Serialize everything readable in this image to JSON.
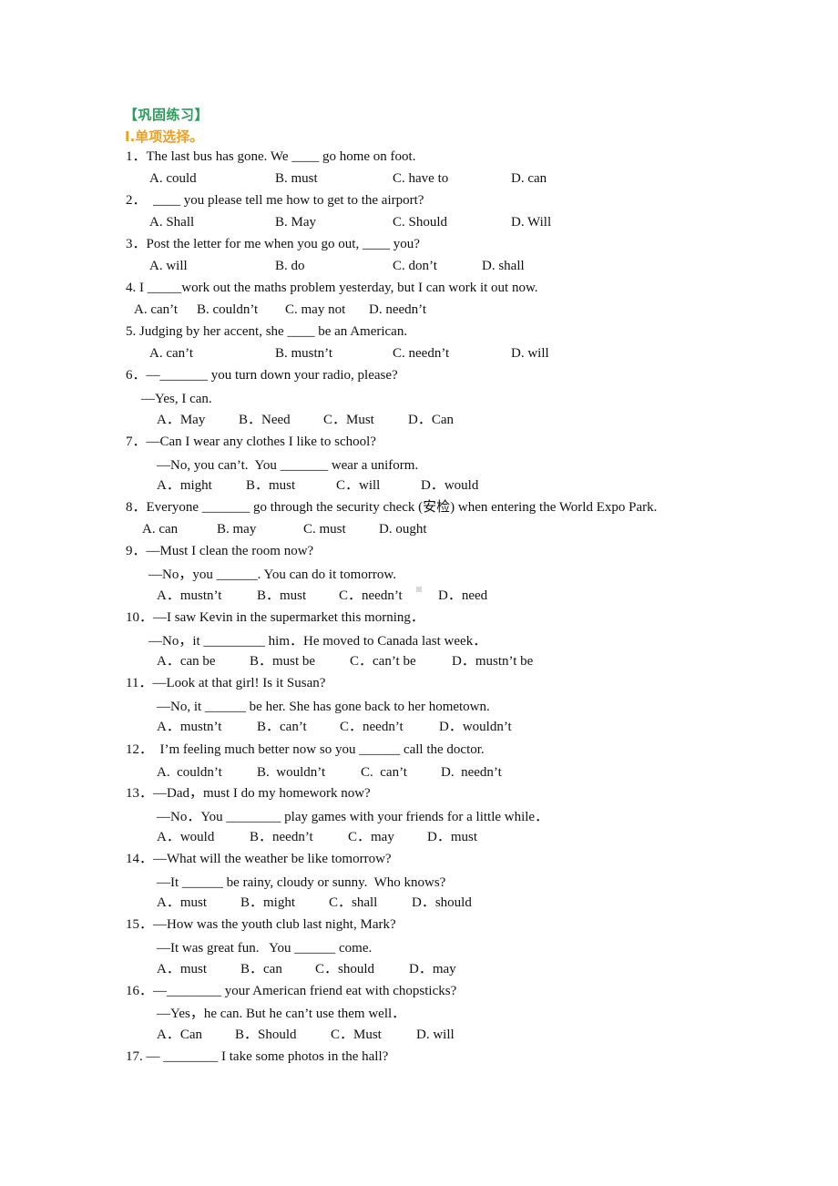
{
  "header": {
    "section_title": "【巩固练习】",
    "part_title": "I.单项选择。"
  },
  "questions": [
    {
      "lines": [
        "1．The last bus has gone. We ____ go home on foot."
      ],
      "options": [
        "A. could",
        "B. must",
        "C. have to",
        "D. can"
      ]
    },
    {
      "lines": [
        "2．  ____ you please tell me how to get to the airport?"
      ],
      "options": [
        "A. Shall",
        "B. May",
        "C. Should",
        "D. Will"
      ]
    },
    {
      "lines": [
        "3．Post the letter for me when you go out, ____ you?"
      ],
      "options": [
        "A. will",
        "B. do",
        "C. don’t",
        "D. shall"
      ]
    },
    {
      "lines": [
        "4. I _____work out the maths problem yesterday, but I can work it out now."
      ],
      "options": [
        "A. can’t",
        "B. couldn’t",
        "C. may not",
        "D. needn’t"
      ]
    },
    {
      "lines": [
        "5. Judging by her accent, she ____ be an American."
      ],
      "options": [
        "A. can’t",
        "B. mustn’t",
        "C. needn’t",
        "D. will"
      ]
    },
    {
      "lines": [
        "6．—_______ you turn down your radio, please?",
        "—Yes, I can."
      ],
      "options": [
        "A．May",
        "B．Need",
        "C．Must",
        "D．Can"
      ]
    },
    {
      "lines": [
        "7．—Can I wear any clothes I like to school?",
        "—No, you can’t.  You _______ wear a uniform."
      ],
      "options": [
        "A．might",
        "B．must",
        "C．will",
        "D．would"
      ]
    },
    {
      "lines": [
        "8．Everyone _______ go through the security check (安检) when entering the World Expo Park."
      ],
      "options": [
        "A. can",
        "B. may",
        "C. must",
        "D. ought"
      ]
    },
    {
      "lines": [
        "9．—Must I clean the room now?",
        "—No，you ______. You can do it tomorrow."
      ],
      "options": [
        "A．mustn’t",
        "B．must",
        "C．needn’t",
        "D．need"
      ]
    },
    {
      "lines": [
        "10．—I saw Kevin in the supermarket this morning．",
        "—No，it _________ him．He moved to Canada last week．"
      ],
      "options": [
        "A．can be",
        "B．must be",
        "C．can’t be",
        "D．mustn’t be"
      ]
    },
    {
      "lines": [
        "11．—Look at that girl! Is it Susan?",
        "—No, it ______ be her. She has gone back to her hometown."
      ],
      "options": [
        "A．mustn’t",
        "B．can’t",
        "C．needn’t",
        "D．wouldn’t"
      ]
    },
    {
      "lines": [
        "12．  I’m feeling much better now so you ______ call the doctor."
      ],
      "options": [
        "A.  couldn’t",
        "B.  wouldn’t",
        "C.  can’t",
        "D.  needn’t"
      ]
    },
    {
      "lines": [
        "13．—Dad，must I do my homework now?",
        "—No．You ________ play games with your friends for a little while．"
      ],
      "options": [
        "A．would",
        "B．needn’t",
        "C．may",
        "D．must"
      ]
    },
    {
      "lines": [
        "14．—What will the weather be like tomorrow?",
        "—It ______ be rainy, cloudy or sunny.  Who knows?"
      ],
      "options": [
        "A．must",
        "B．might",
        "C．shall",
        "D．should"
      ]
    },
    {
      "lines": [
        "15．—How was the youth club last night, Mark?",
        "—It was great fun.   You ______ come."
      ],
      "options": [
        "A．must",
        "B．can",
        "C．should",
        "D．may"
      ]
    },
    {
      "lines": [
        "16．—________ your American friend eat with chopsticks?",
        "—Yes，he can. But he can’t use them well．"
      ],
      "options": [
        "A．Can",
        "B．Should",
        "C．Must",
        "D. will"
      ]
    },
    {
      "lines": [
        "17. — ________ I take some photos in the hall?"
      ],
      "options": []
    }
  ]
}
